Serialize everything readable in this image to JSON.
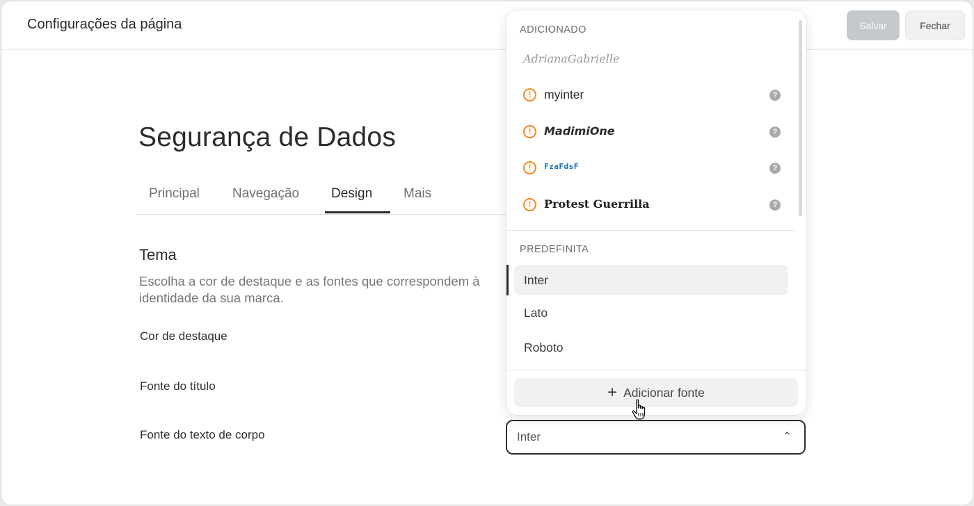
{
  "header": {
    "title": "Configurações da página",
    "save_label": "Salvar",
    "close_label": "Fechar"
  },
  "page": {
    "heading": "Segurança de Dados",
    "tabs": [
      {
        "label": "Principal"
      },
      {
        "label": "Navegação"
      },
      {
        "label": "Design",
        "active": true
      },
      {
        "label": "Mais"
      }
    ]
  },
  "theme": {
    "title": "Tema",
    "description": "Escolha a cor de destaque e as fontes que correspondem à identidade da sua marca.",
    "fields": {
      "accent_color": "Cor de destaque",
      "title_font": "Fonte do título",
      "body_font": "Fonte do texto de corpo"
    },
    "body_font_value": "Inter"
  },
  "dropdown": {
    "added_label": "ADICIONADO",
    "added_fonts": [
      {
        "name": "AdrianaGabrielle",
        "warning": false
      },
      {
        "name": "myinter",
        "warning": true
      },
      {
        "name": "MadimiOne",
        "warning": true
      },
      {
        "name": "FzaFdsF",
        "warning": true
      },
      {
        "name": "Protest Guerrilla",
        "warning": true
      }
    ],
    "preset_label": "PREDEFINITA",
    "preset_fonts": [
      {
        "name": "Inter",
        "selected": true
      },
      {
        "name": "Lato"
      },
      {
        "name": "Roboto"
      }
    ],
    "add_font_label": "Adicionar fonte"
  },
  "colors": {
    "warning": "#f08a24",
    "save_disabled": "#c5c8cc",
    "text_primary": "#2b2b2b"
  },
  "icons": {
    "warning": "exclamation-circle-icon",
    "help": "question-circle-icon",
    "chevron": "chevron-up-icon",
    "add": "plus-icon",
    "cursor": "hand-pointer-cursor"
  }
}
